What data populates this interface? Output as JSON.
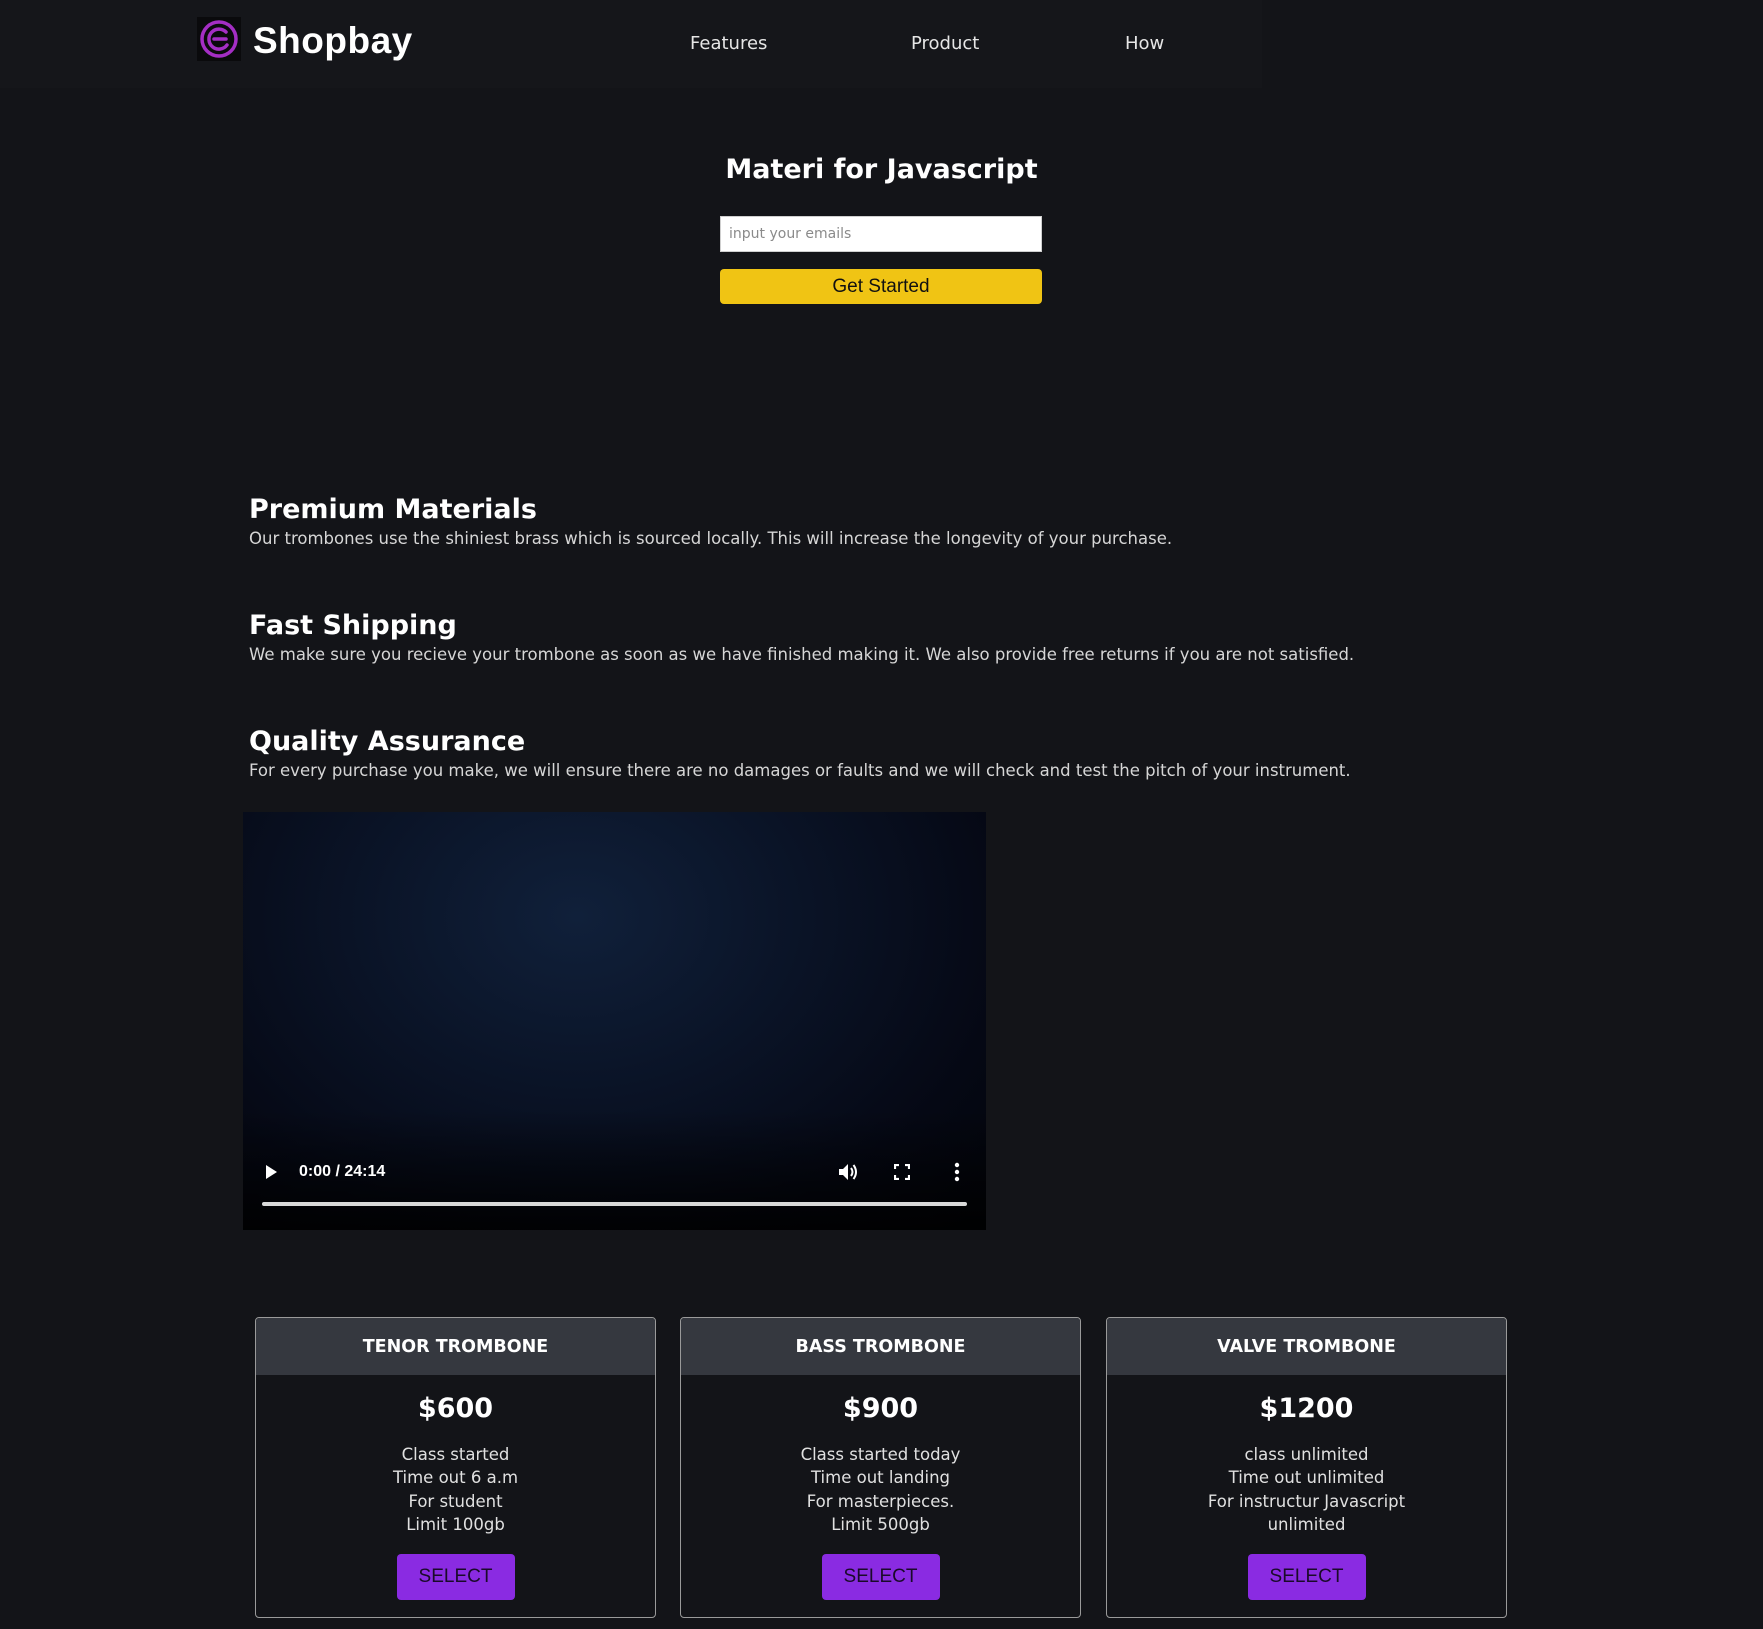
{
  "header": {
    "brand": "Shopbay",
    "nav": [
      "Features",
      "Product",
      "How"
    ]
  },
  "hero": {
    "title": "Materi for Javascript",
    "email_placeholder": "input your emails",
    "cta_label": "Get Started"
  },
  "features": [
    {
      "title": "Premium Materials",
      "description": "Our trombones use the shiniest brass which is sourced locally. This will increase the longevity of your purchase."
    },
    {
      "title": "Fast Shipping",
      "description": "We make sure you recieve your trombone as soon as we have finished making it. We also provide free returns if you are not satisfied."
    },
    {
      "title": "Quality Assurance",
      "description": "For every purchase you make, we will ensure there are no damages or faults and we will check and test the pitch of your instrument."
    }
  ],
  "video": {
    "time": "0:00 / 24:14",
    "progress_fraction": 0
  },
  "pricing": [
    {
      "name": "TENOR TROMBONE",
      "price": "$600",
      "lines": [
        "Class started",
        "Time out 6 a.m",
        "For student",
        "Limit 100gb"
      ],
      "button": "SELECT"
    },
    {
      "name": "BASS TROMBONE",
      "price": "$900",
      "lines": [
        "Class started today",
        "Time out landing",
        "For masterpieces.",
        "Limit 500gb"
      ],
      "button": "SELECT"
    },
    {
      "name": "VALVE TROMBONE",
      "price": "$1200",
      "lines": [
        "class unlimited",
        "Time out unlimited",
        "For instructur Javascript",
        "unlimited"
      ],
      "button": "SELECT"
    }
  ],
  "colors": {
    "background": "#131418",
    "accent_yellow": "#f0c414",
    "accent_purple": "#8a2be2",
    "menu_green": "#0f8f0f"
  },
  "icons": [
    "menu-icon",
    "logo-icon",
    "play-icon",
    "volume-icon",
    "fullscreen-icon",
    "more-options-icon"
  ]
}
